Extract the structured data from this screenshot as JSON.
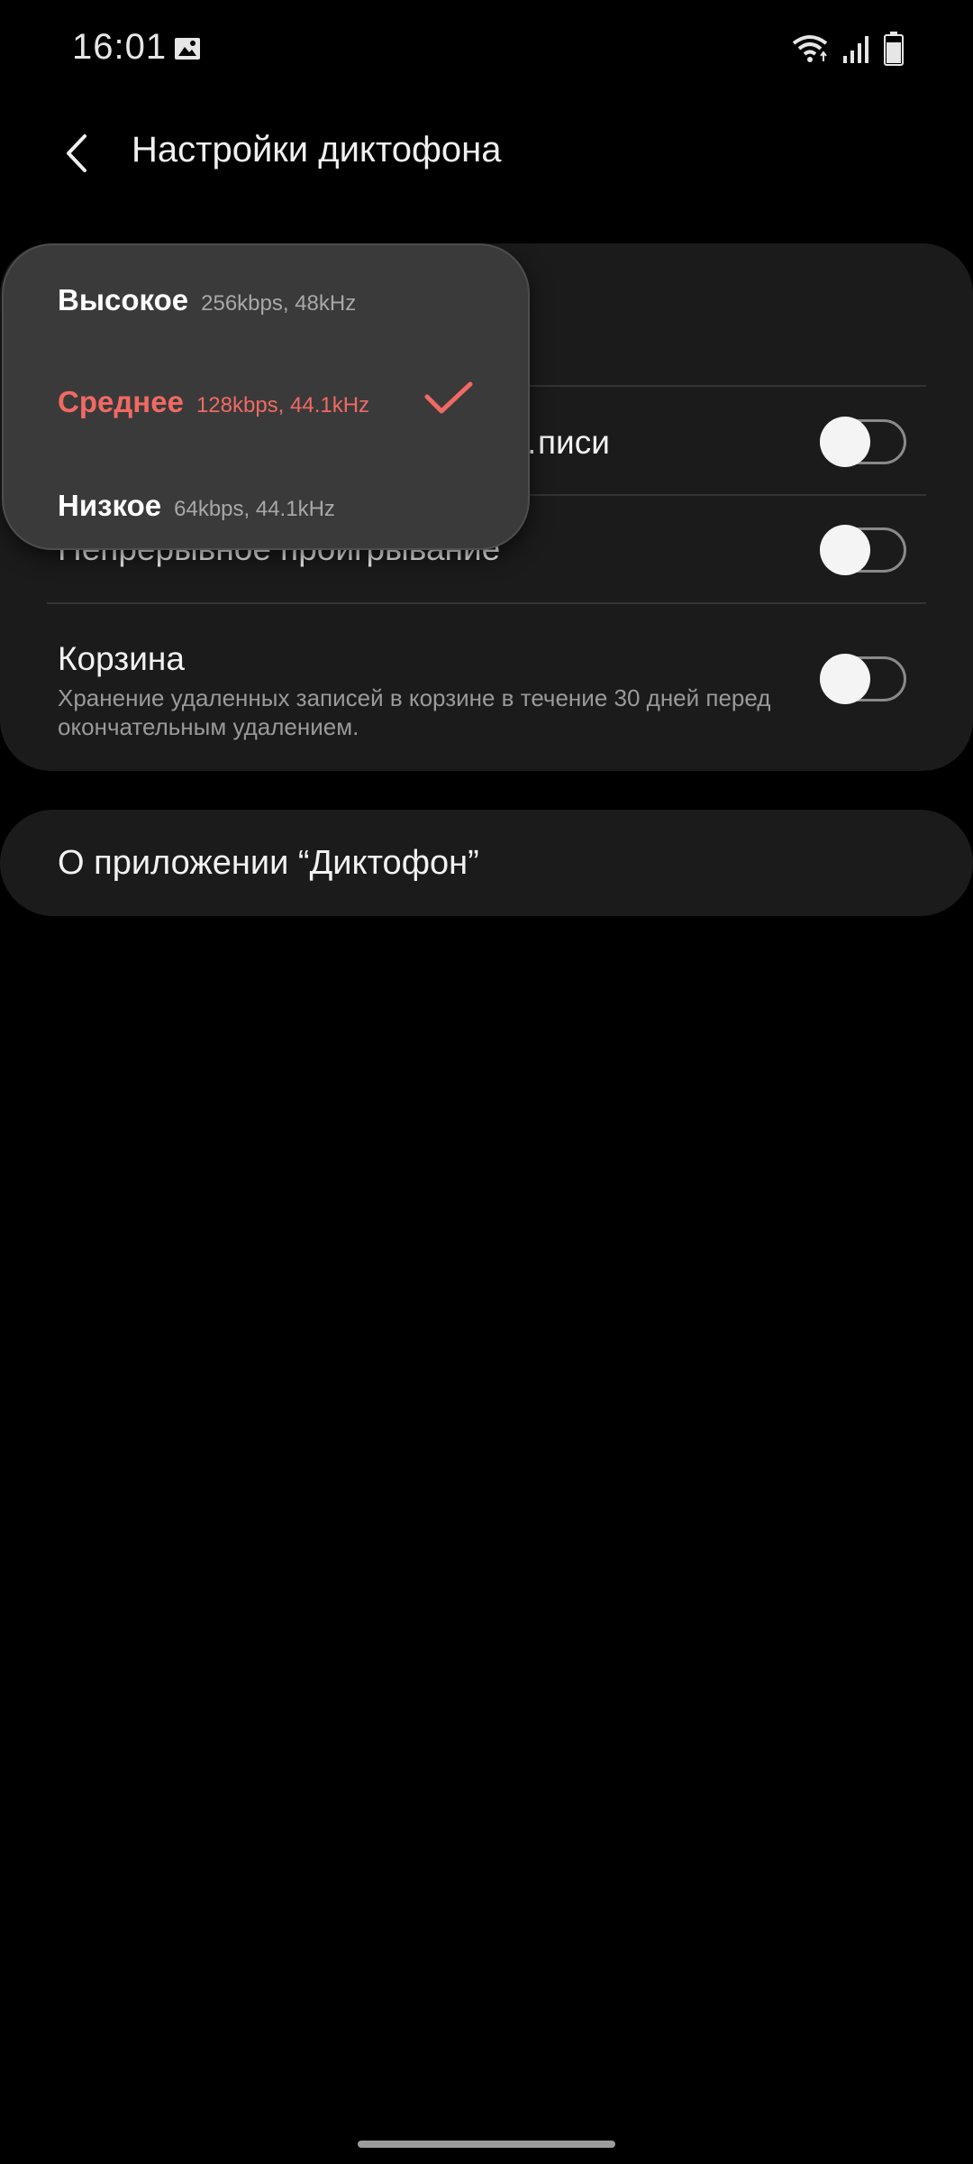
{
  "status_bar": {
    "time": "16:01",
    "icons": [
      "gallery-icon",
      "wifi-icon",
      "signal-icon",
      "battery-icon"
    ]
  },
  "header": {
    "title": "Настройки диктофона",
    "back_icon": "chevron-left-icon"
  },
  "settings": {
    "items": [
      {
        "title": "…писи",
        "toggle_on": false
      },
      {
        "title": "Непрерывное проигрывание",
        "toggle_on": false
      },
      {
        "title": "Корзина",
        "subtitle": "Хранение удаленных записей в корзине в течение 30 дней перед окончательным удалением.",
        "toggle_on": false
      }
    ]
  },
  "about": {
    "label": "О приложении “Диктофон”"
  },
  "quality_menu": {
    "options": [
      {
        "name": "Высокое",
        "detail": "256kbps, 48kHz",
        "selected": false
      },
      {
        "name": "Среднее",
        "detail": "128kbps, 44.1kHz",
        "selected": true
      },
      {
        "name": "Низкое",
        "detail": "64kbps, 44.1kHz",
        "selected": false
      }
    ],
    "check_icon": "check-icon"
  },
  "colors": {
    "background": "#000000",
    "card": "#1b1b1b",
    "popup": "#3a3a3a",
    "accent": "#f06a63",
    "text_primary": "#f2f2f2",
    "text_secondary": "#9a9a9a"
  }
}
